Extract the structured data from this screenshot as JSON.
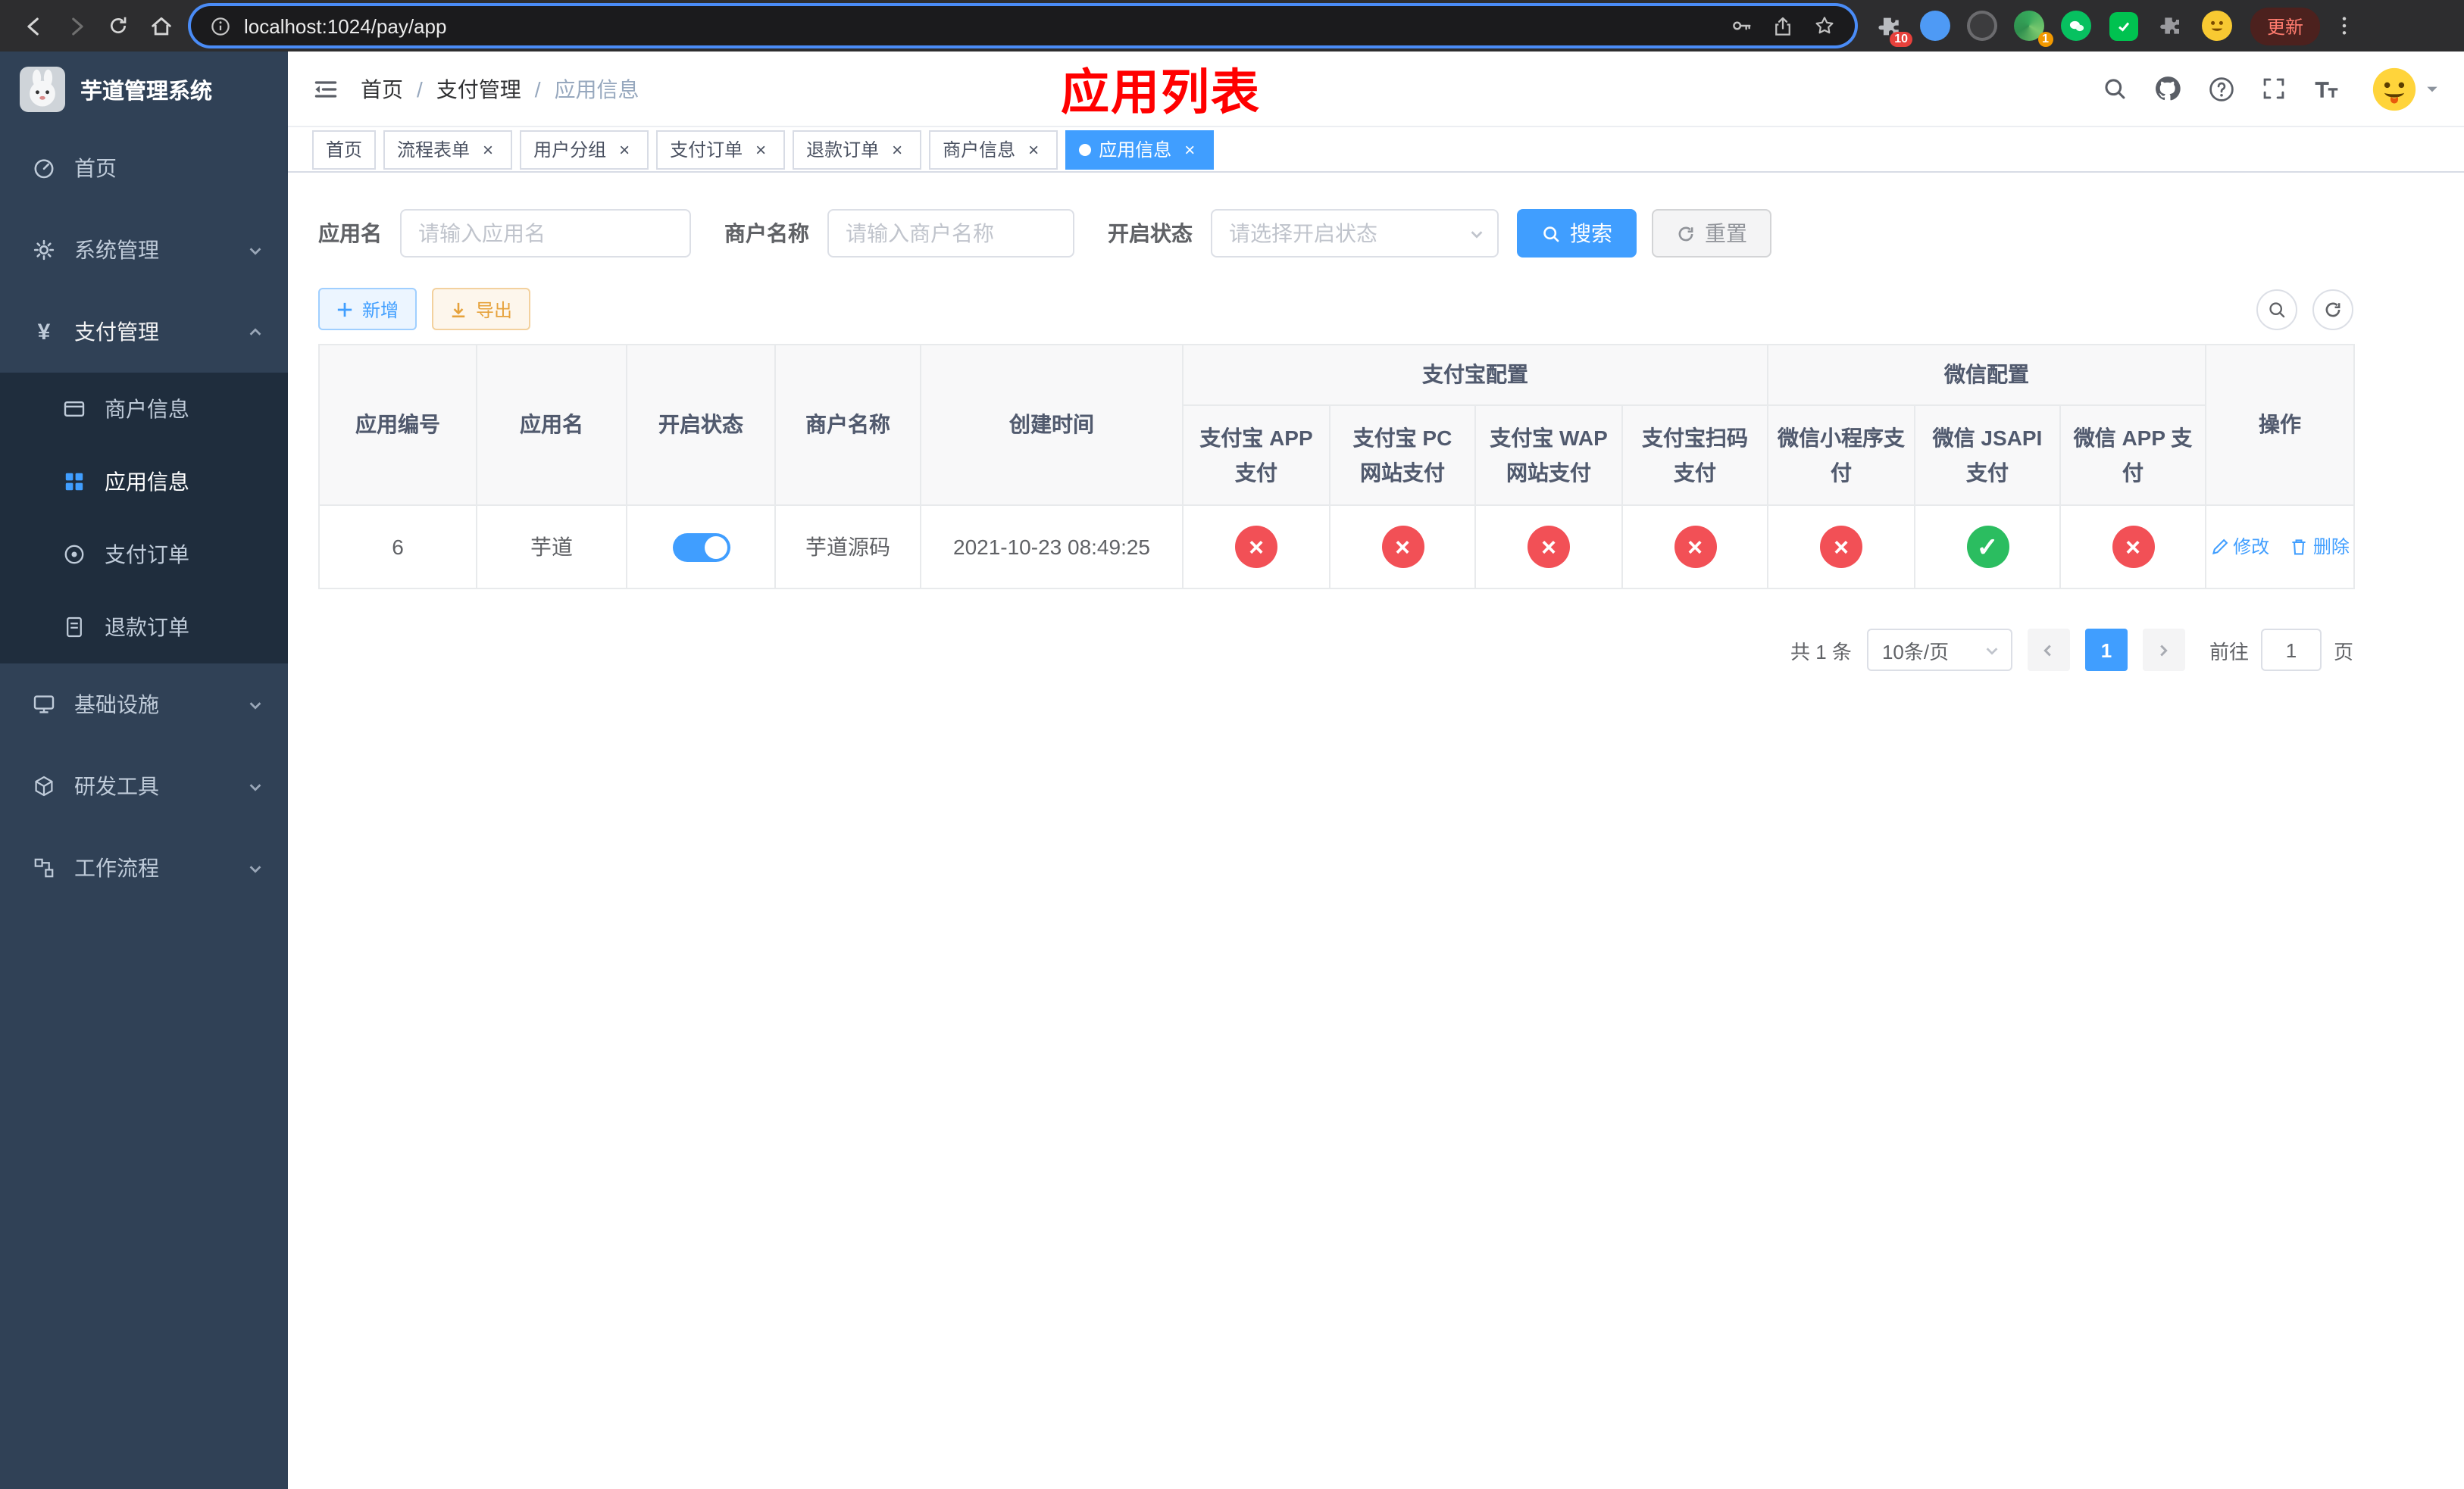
{
  "colors": {
    "primary": "#409eff",
    "success": "#2bbd60",
    "danger": "#f25056",
    "warning": "#e6a23c",
    "sidebar_bg": "#304156",
    "sidebar_submenu_bg": "#1f2d3d",
    "annotation_red": "#ff0000"
  },
  "browser": {
    "url": "localhost:1024/pay/app",
    "update_button": "更新",
    "extension_badge_puzzle": "10",
    "extension_badge_colorful": "1"
  },
  "sidebar": {
    "app_title": "芋道管理系统",
    "home": "首页",
    "system": "系统管理",
    "payment": "支付管理",
    "merchant_info": "商户信息",
    "app_info": "应用信息",
    "pay_order": "支付订单",
    "refund_order": "退款订单",
    "infra": "基础设施",
    "dev_tools": "研发工具",
    "workflow": "工作流程"
  },
  "header": {
    "breadcrumb": {
      "home": "首页",
      "section": "支付管理",
      "current": "应用信息"
    },
    "annotation": "应用列表"
  },
  "tabs": [
    {
      "label": "首页"
    },
    {
      "label": "流程表单"
    },
    {
      "label": "用户分组"
    },
    {
      "label": "支付订单"
    },
    {
      "label": "退款订单"
    },
    {
      "label": "商户信息"
    },
    {
      "label": "应用信息"
    }
  ],
  "filters": {
    "app_name_label": "应用名",
    "app_name_placeholder": "请输入应用名",
    "merchant_label": "商户名称",
    "merchant_placeholder": "请输入商户名称",
    "status_label": "开启状态",
    "status_placeholder": "请选择开启状态",
    "search_button": "搜索",
    "reset_button": "重置"
  },
  "toolbar": {
    "add_button": "新增",
    "export_button": "导出"
  },
  "table": {
    "headers": {
      "app_id": "应用编号",
      "app_name": "应用名",
      "status": "开启状态",
      "merchant": "商户名称",
      "created": "创建时间",
      "alipay_group": "支付宝配置",
      "wechat_group": "微信配置",
      "alipay_app": "支付宝 APP 支付",
      "alipay_pc": "支付宝 PC 网站支付",
      "alipay_wap": "支付宝 WAP 网站支付",
      "alipay_qr": "支付宝扫码支付",
      "wechat_mini": "微信小程序支付",
      "wechat_jsapi": "微信 JSAPI 支付",
      "wechat_app": "微信 APP 支付",
      "actions": "操作"
    },
    "row": {
      "id": "6",
      "name": "芋道",
      "enabled": true,
      "merchant": "芋道源码",
      "created": "2021-10-23 08:49:25",
      "configs": [
        false,
        false,
        false,
        false,
        false,
        true,
        false
      ],
      "edit_button": "修改",
      "delete_button": "删除"
    }
  },
  "pagination": {
    "total": "共 1 条",
    "page_size": "10条/页",
    "current_page": "1",
    "goto_label": "前往",
    "goto_value": "1",
    "page_suffix": "页"
  }
}
